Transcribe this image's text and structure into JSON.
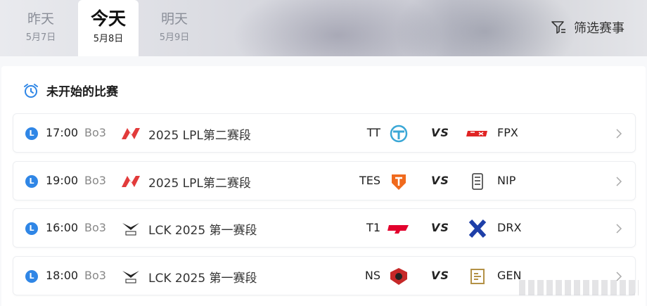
{
  "day_tabs": [
    {
      "name": "昨天",
      "date": "5月7日",
      "active": false
    },
    {
      "name": "今天",
      "date": "5月8日",
      "active": true
    },
    {
      "name": "明天",
      "date": "5月9日",
      "active": false
    }
  ],
  "filter": {
    "label": "筛选赛事",
    "icon": "filter-icon"
  },
  "section": {
    "title": "未开始的比赛",
    "icon": "alarm-clock-icon"
  },
  "colors": {
    "accent_blue": "#2f86e6",
    "lpl_red": "#e23b3b",
    "active_tab_bg": "#ffffff"
  },
  "matches": [
    {
      "live_badge": "L",
      "time": "17:00",
      "format": "Bo3",
      "league_icon": "lpl-logo",
      "league": "2025 LPL第二赛段",
      "team_a": "TT",
      "team_a_icon": "tt-logo",
      "vs": "VS",
      "team_b": "FPX",
      "team_b_icon": "fpx-logo"
    },
    {
      "live_badge": "L",
      "time": "19:00",
      "format": "Bo3",
      "league_icon": "lpl-logo",
      "league": "2025 LPL第二赛段",
      "team_a": "TES",
      "team_a_icon": "tes-logo",
      "vs": "VS",
      "team_b": "NIP",
      "team_b_icon": "nip-logo"
    },
    {
      "live_badge": "L",
      "time": "16:00",
      "format": "Bo3",
      "league_icon": "lck-logo",
      "league": "LCK 2025 第一赛段",
      "team_a": "T1",
      "team_a_icon": "t1-logo",
      "vs": "VS",
      "team_b": "DRX",
      "team_b_icon": "drx-logo"
    },
    {
      "live_badge": "L",
      "time": "18:00",
      "format": "Bo3",
      "league_icon": "lck-logo",
      "league": "LCK 2025 第一赛段",
      "team_a": "NS",
      "team_a_icon": "ns-logo",
      "vs": "VS",
      "team_b": "GEN",
      "team_b_icon": "gen-logo"
    }
  ]
}
